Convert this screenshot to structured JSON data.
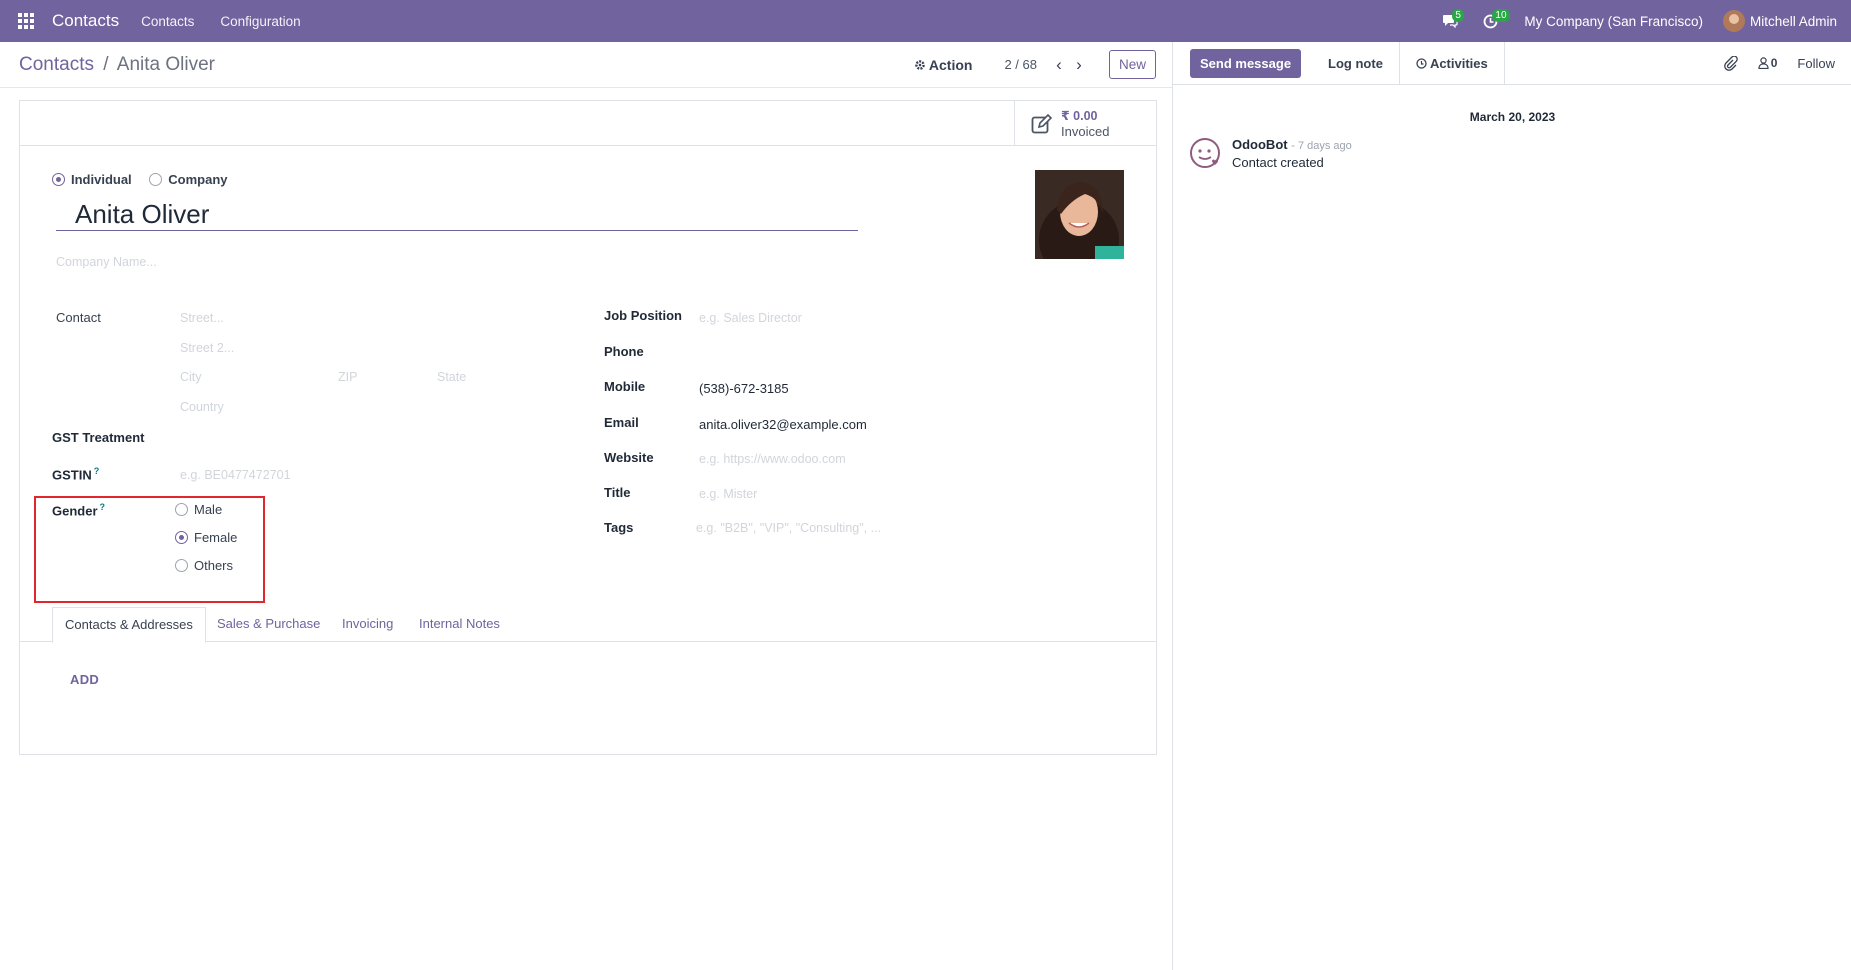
{
  "navbar": {
    "app_name": "Contacts",
    "menus": [
      "Contacts",
      "Configuration"
    ],
    "messages_badge": "5",
    "activities_badge": "10",
    "company": "My Company (San Francisco)",
    "user": "Mitchell Admin"
  },
  "control_panel": {
    "breadcrumb_root": "Contacts",
    "breadcrumb_sep": "/",
    "breadcrumb_current": "Anita Oliver",
    "action_label": "Action",
    "pager": "2 / 68",
    "new_label": "New"
  },
  "stat_button": {
    "value": "₹ 0.00",
    "label": "Invoiced"
  },
  "form": {
    "type_options": [
      "Individual",
      "Company"
    ],
    "type_selected": "Individual",
    "name": "Anita Oliver",
    "company_placeholder": "Company Name...",
    "contact_label": "Contact",
    "street_placeholder": "Street...",
    "street2_placeholder": "Street 2...",
    "city_placeholder": "City",
    "zip_placeholder": "ZIP",
    "state_placeholder": "State",
    "country_placeholder": "Country",
    "gst_treatment_label": "GST Treatment",
    "gstin_label": "GSTIN",
    "gstin_placeholder": "e.g. BE0477472701",
    "help_mark": "?",
    "gender_label": "Gender",
    "gender_options": [
      "Male",
      "Female",
      "Others"
    ],
    "gender_selected": "Female",
    "job_position_label": "Job Position",
    "job_position_placeholder": "e.g. Sales Director",
    "phone_label": "Phone",
    "mobile_label": "Mobile",
    "mobile_value": "(538)-672-3185",
    "email_label": "Email",
    "email_value": "anita.oliver32@example.com",
    "website_label": "Website",
    "website_placeholder": "e.g. https://www.odoo.com",
    "title_label": "Title",
    "title_placeholder": "e.g. Mister",
    "tags_label": "Tags",
    "tags_placeholder": "e.g. \"B2B\", \"VIP\", \"Consulting\", ..."
  },
  "tabs": [
    "Contacts & Addresses",
    "Sales & Purchase",
    "Invoicing",
    "Internal Notes"
  ],
  "active_tab": "Contacts & Addresses",
  "add_label": "ADD",
  "chatter": {
    "send_message": "Send message",
    "log_note": "Log note",
    "activities": "Activities",
    "followers_count": "0",
    "follow": "Follow",
    "date": "March 20, 2023",
    "author": "OdooBot",
    "ago": "- 7 days ago",
    "message": "Contact created"
  },
  "colors": {
    "brand": "#71639e",
    "highlight": "#e0272e",
    "badge": "#28a745"
  }
}
